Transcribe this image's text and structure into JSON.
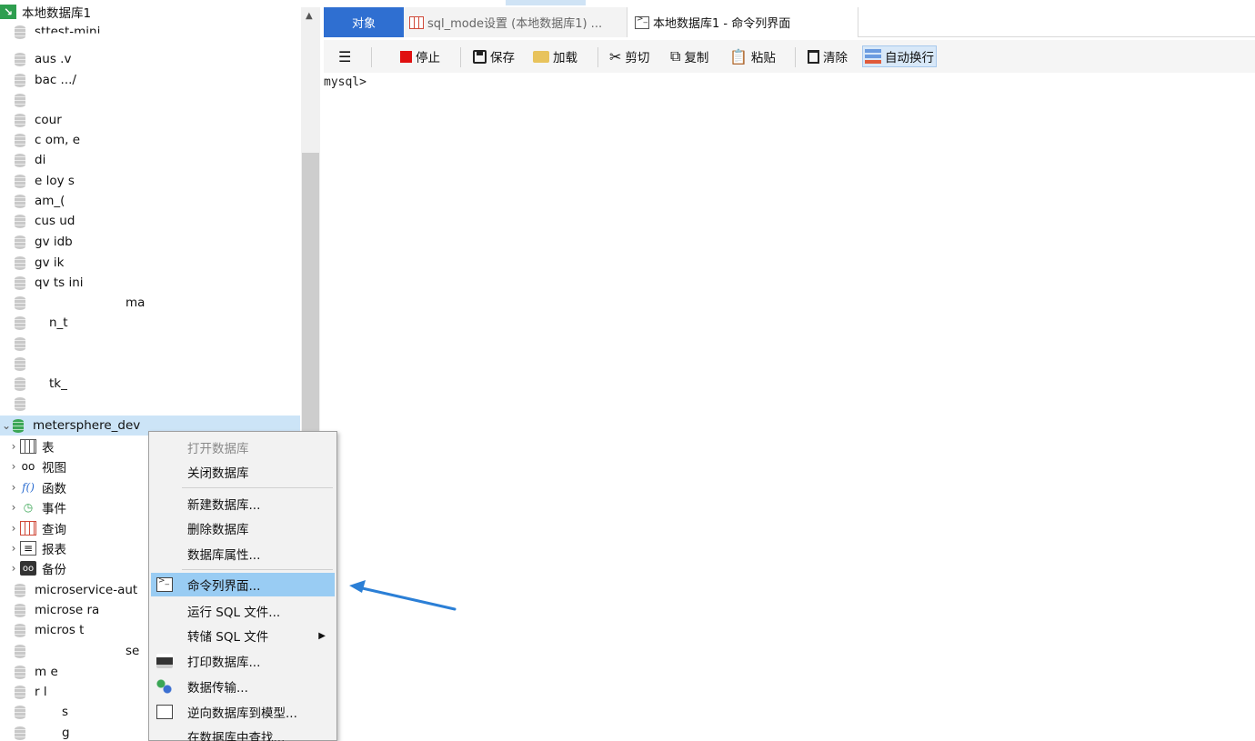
{
  "tree": {
    "connection_label": "本地数据库1",
    "databases_top": [
      "sttest-mini",
      "aus .v",
      "bac .../",
      "",
      "cour",
      "c om, e",
      "di",
      "e loy s",
      "am_(",
      "cus ud",
      "gv idb",
      "gv ik",
      "qv ts ini",
      "ma",
      "n_t",
      "",
      "",
      "tk_",
      ""
    ],
    "selected_db": "metersphere_dev",
    "children": [
      {
        "label": "表",
        "icon": "table-icon"
      },
      {
        "label": "视图",
        "icon": "view-icon"
      },
      {
        "label": "函数",
        "icon": "function-icon"
      },
      {
        "label": "事件",
        "icon": "event-icon"
      },
      {
        "label": "查询",
        "icon": "query-icon"
      },
      {
        "label": "报表",
        "icon": "report-icon"
      },
      {
        "label": "备份",
        "icon": "backup-icon"
      }
    ],
    "databases_bottom": [
      "microservice-aut",
      "microse ra",
      "micros t",
      "se",
      "m e",
      "r l",
      "s",
      "g"
    ]
  },
  "tabs": {
    "objects": "对象",
    "sql_mode": "sql_mode设置 (本地数据库1) ...",
    "command": "本地数据库1 - 命令列界面"
  },
  "toolbar": {
    "menu_glyph": "☰",
    "stop": "停止",
    "save": "保存",
    "load": "加载",
    "cut": "剪切",
    "copy": "复制",
    "paste": "粘贴",
    "clear": "清除",
    "auto_wrap": "自动换行"
  },
  "editor": {
    "prompt": "mysql>"
  },
  "context_menu": {
    "items": [
      {
        "label": "打开数据库",
        "disabled": true
      },
      {
        "label": "关闭数据库"
      },
      {
        "label": "新建数据库..."
      },
      {
        "label": "删除数据库"
      },
      {
        "label": "数据库属性..."
      },
      {
        "label": "命令列界面...",
        "highlighted": true
      },
      {
        "label": "运行 SQL 文件..."
      },
      {
        "label": "转储 SQL 文件"
      },
      {
        "label": "打印数据库..."
      },
      {
        "label": "数据传输..."
      },
      {
        "label": "逆向数据库到模型..."
      },
      {
        "label": "在数据库中查找..."
      }
    ],
    "submenu_glyph": "▶"
  },
  "colors": {
    "tab_active": "#2f6fd1",
    "menu_highlight": "#99ccf3",
    "selection": "#cce4f7",
    "annotation_arrow": "#2b7fd6",
    "stop_red": "#e01010"
  }
}
